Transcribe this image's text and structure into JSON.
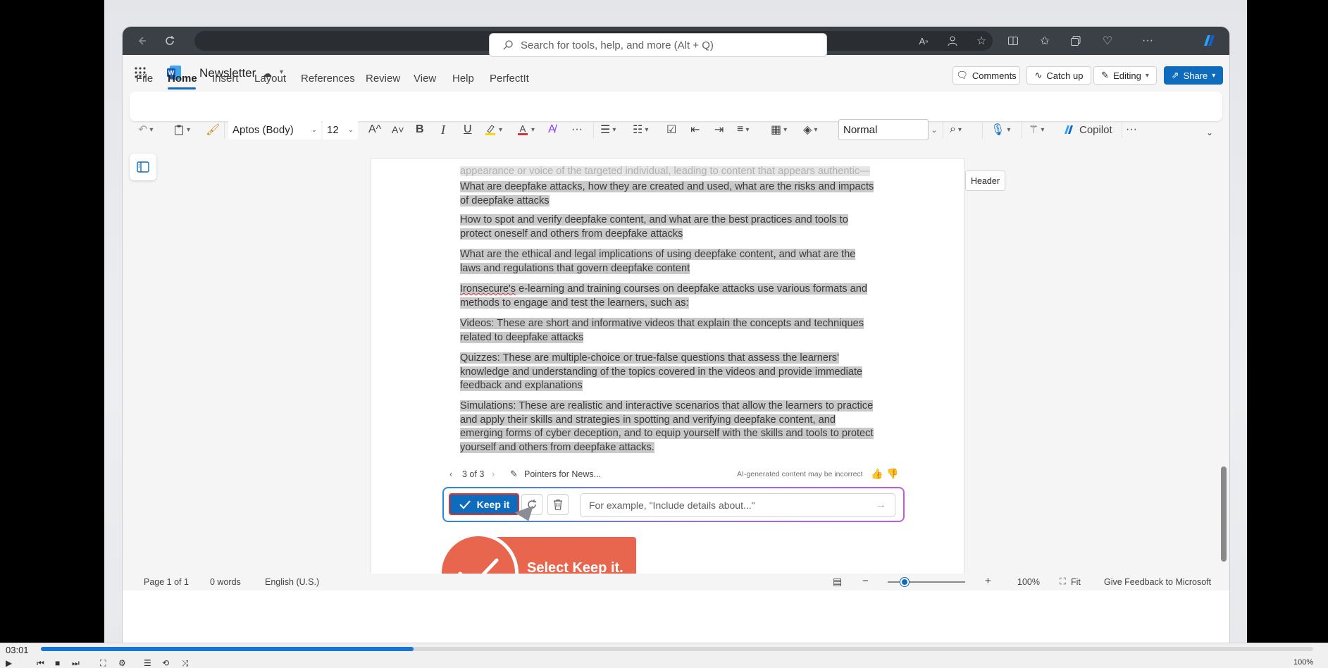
{
  "player": {
    "elapsed": "03:01",
    "progress_fraction": 0.293,
    "zoom": "100%"
  },
  "app": {
    "doc_title": "Newsletter",
    "search_placeholder": "Search for tools, help, and more (Alt + Q)",
    "tabs": [
      "File",
      "Home",
      "Insert",
      "Layout",
      "References",
      "Review",
      "View",
      "Help",
      "PerfectIt"
    ],
    "active_tab": "Home",
    "comments_label": "Comments",
    "catchup_label": "Catch up",
    "editing_label": "Editing",
    "share_label": "Share",
    "header_tag": "Header"
  },
  "toolbar": {
    "font_name": "Aptos (Body)",
    "font_size": "12",
    "style": "Normal",
    "copilot_label": "Copilot",
    "bold": "B",
    "italic": "I",
    "underline": "U",
    "grow": "A^",
    "shrink": "A˅"
  },
  "document": {
    "faded_line": "appearance or voice of the targeted individual, leading to content that appears authentic—",
    "paragraphs": [
      "What are deepfake attacks, how they are created and used, what are the risks and impacts of deepfake attacks",
      "How to spot and verify deepfake content, and what are the best practices and tools to protect oneself and others from deepfake attacks",
      "What are the ethical and legal implications of using deepfake content, and what are the laws and regulations that govern deepfake content",
      "e-learning and training courses on deepfake attacks use various formats and methods to engage and test the learners, such as:",
      "Videos: These are short and informative videos that explain the concepts and techniques related to deepfake attacks",
      "Quizzes: These are multiple-choice or true-false questions that assess the learners' knowledge and understanding of the topics covered in the videos and provide immediate feedback and explanations",
      "Simulations: These are realistic and interactive scenarios that allow the learners to practice and apply their skills and strategies in spotting and verifying deepfake content, and emerging forms of cyber deception, and to equip yourself with the skills and tools to protect yourself and others from deepfake attacks."
    ],
    "misspelled_word": "Ironsecure's"
  },
  "copilot": {
    "pager": "3 of 3",
    "source": "Pointers for News...",
    "disclaimer": "AI-generated content may be incorrect",
    "keep_label": "Keep it",
    "prompt_placeholder": "For example, \"Include details about...\""
  },
  "callout": {
    "text": "Select Keep it."
  },
  "status": {
    "page": "Page 1 of 1",
    "words": "0 words",
    "language": "English (U.S.)",
    "zoom": "100%",
    "fit": "Fit",
    "feedback": "Give Feedback to Microsoft",
    "zoom_fraction": 0.22
  },
  "colors": {
    "word_blue": "#0f6cbd",
    "callout": "#e8664e",
    "highlight": "#c9c9c9",
    "seek": "#1a73d9"
  }
}
